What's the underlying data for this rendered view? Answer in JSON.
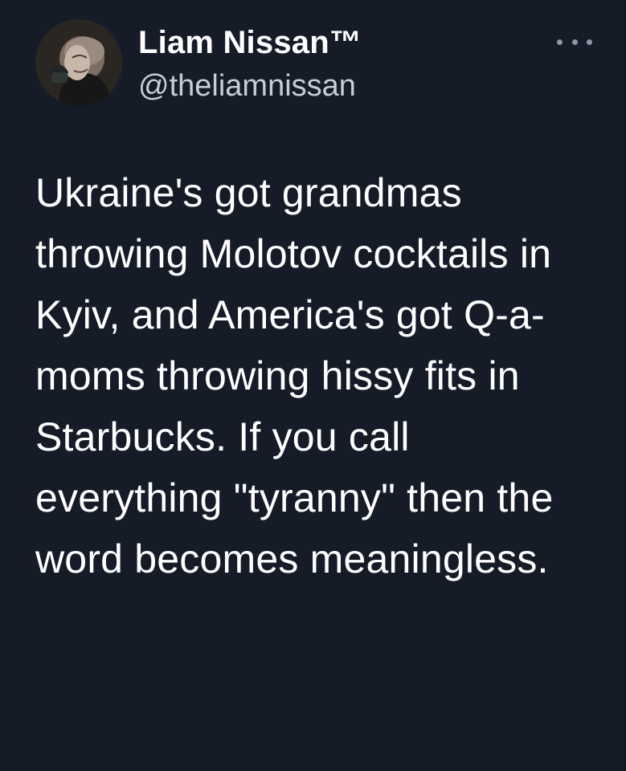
{
  "tweet": {
    "author": {
      "display_name": "Liam Nissan™",
      "handle": "@theliamnissan"
    },
    "text": "Ukraine's got grandmas throwing Molotov cocktails in Kyiv, and America's got Q-a-moms throwing hissy fits in Starbucks. If you call everything \"tyranny\" then the word becomes meaningless.",
    "more_icon": "more-horizontal-icon"
  },
  "colors": {
    "background": "#151c28",
    "text": "#ffffff",
    "secondary_text": "#c8cdd3",
    "muted": "#8b98a5",
    "link": "#1d9bf0"
  }
}
